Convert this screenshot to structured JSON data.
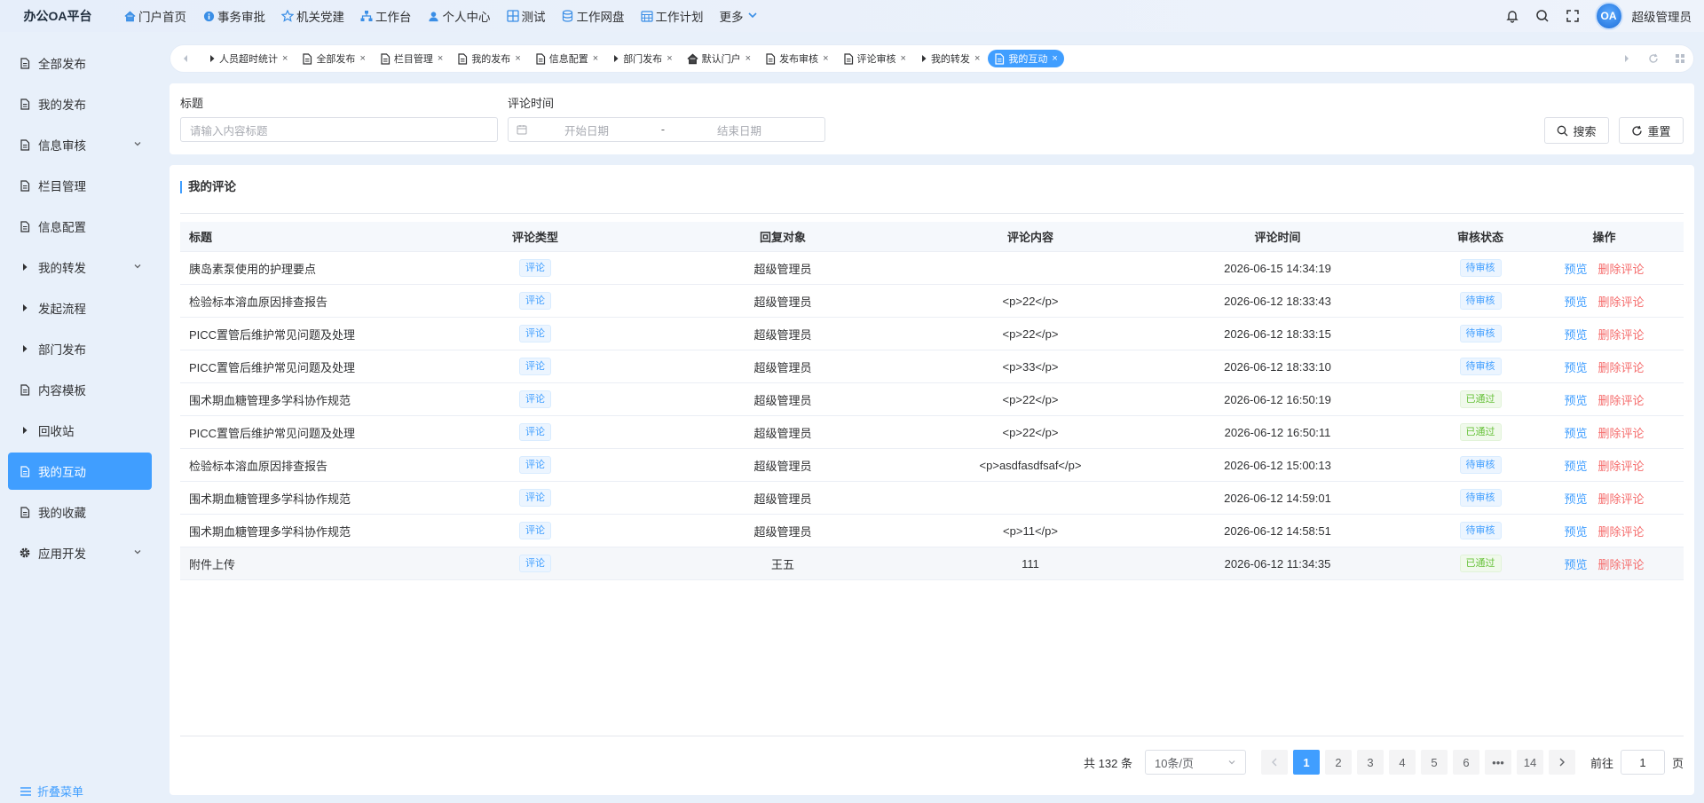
{
  "brand": "办公OA平台",
  "nav": [
    {
      "label": "门户首页",
      "icon": "home-icon"
    },
    {
      "label": "事务审批",
      "icon": "info-icon"
    },
    {
      "label": "机关党建",
      "icon": "star-icon"
    },
    {
      "label": "工作台",
      "icon": "sitemap-icon"
    },
    {
      "label": "个人中心",
      "icon": "user-icon"
    },
    {
      "label": "测试",
      "icon": "grid-icon"
    },
    {
      "label": "工作网盘",
      "icon": "database-icon"
    },
    {
      "label": "工作计划",
      "icon": "calendar-icon"
    }
  ],
  "nav_more": "更多",
  "username": "超级管理员",
  "avatar_text": "OA",
  "sidebar": {
    "items": [
      {
        "label": "全部发布",
        "icon": "document-icon",
        "arrow": false
      },
      {
        "label": "我的发布",
        "icon": "document-icon",
        "arrow": false
      },
      {
        "label": "信息审核",
        "icon": "document-icon",
        "arrow": true
      },
      {
        "label": "栏目管理",
        "icon": "document-icon",
        "arrow": false
      },
      {
        "label": "信息配置",
        "icon": "document-icon",
        "arrow": false
      },
      {
        "label": "我的转发",
        "icon": "caret-right-icon",
        "arrow": true
      },
      {
        "label": "发起流程",
        "icon": "caret-right-icon",
        "arrow": false
      },
      {
        "label": "部门发布",
        "icon": "caret-right-icon",
        "arrow": false
      },
      {
        "label": "内容模板",
        "icon": "document-icon",
        "arrow": false
      },
      {
        "label": "回收站",
        "icon": "caret-right-icon",
        "arrow": false
      },
      {
        "label": "我的互动",
        "icon": "document-icon",
        "arrow": false,
        "active": true
      },
      {
        "label": "我的收藏",
        "icon": "document-icon",
        "arrow": false
      },
      {
        "label": "应用开发",
        "icon": "gear-icon",
        "arrow": true
      }
    ],
    "collapse_label": "折叠菜单"
  },
  "tabs": [
    {
      "label": "人员超时统计",
      "icon": "caret-right-icon"
    },
    {
      "label": "全部发布",
      "icon": "document-icon"
    },
    {
      "label": "栏目管理",
      "icon": "document-icon"
    },
    {
      "label": "我的发布",
      "icon": "document-icon"
    },
    {
      "label": "信息配置",
      "icon": "document-icon"
    },
    {
      "label": "部门发布",
      "icon": "caret-right-icon"
    },
    {
      "label": "默认门户",
      "icon": "home-icon"
    },
    {
      "label": "发布审核",
      "icon": "document-icon"
    },
    {
      "label": "评论审核",
      "icon": "document-icon"
    },
    {
      "label": "我的转发",
      "icon": "caret-right-icon"
    },
    {
      "label": "我的互动",
      "icon": "document-icon",
      "active": true
    }
  ],
  "search": {
    "title_label": "标题",
    "title_placeholder": "请输入内容标题",
    "time_label": "评论时间",
    "start_placeholder": "开始日期",
    "range_sep": "-",
    "end_placeholder": "结束日期",
    "search_button": "搜索",
    "reset_button": "重置"
  },
  "card": {
    "title": "我的评论",
    "columns": [
      "标题",
      "评论类型",
      "回复对象",
      "评论内容",
      "评论时间",
      "审核状态",
      "操作"
    ],
    "rows": [
      {
        "title": "胰岛素泵使用的护理要点",
        "type": "评论",
        "target": "超级管理员",
        "content": "",
        "time": "2026-06-15 14:34:19",
        "status": "待审核",
        "ok": false
      },
      {
        "title": "检验标本溶血原因排查报告",
        "type": "评论",
        "target": "超级管理员",
        "content": "<p>22</p>",
        "time": "2026-06-12 18:33:43",
        "status": "待审核",
        "ok": false
      },
      {
        "title": "PICC置管后维护常见问题及处理",
        "type": "评论",
        "target": "超级管理员",
        "content": "<p>22</p>",
        "time": "2026-06-12 18:33:15",
        "status": "待审核",
        "ok": false
      },
      {
        "title": "PICC置管后维护常见问题及处理",
        "type": "评论",
        "target": "超级管理员",
        "content": "<p>33</p>",
        "time": "2026-06-12 18:33:10",
        "status": "待审核",
        "ok": false
      },
      {
        "title": "围术期血糖管理多学科协作规范",
        "type": "评论",
        "target": "超级管理员",
        "content": "<p>22</p>",
        "time": "2026-06-12 16:50:19",
        "status": "已通过",
        "ok": true
      },
      {
        "title": "PICC置管后维护常见问题及处理",
        "type": "评论",
        "target": "超级管理员",
        "content": "<p>22</p>",
        "time": "2026-06-12 16:50:11",
        "status": "已通过",
        "ok": true
      },
      {
        "title": "检验标本溶血原因排查报告",
        "type": "评论",
        "target": "超级管理员",
        "content": "<p>asdfasdfsaf</p>",
        "time": "2026-06-12 15:00:13",
        "status": "待审核",
        "ok": false
      },
      {
        "title": "围术期血糖管理多学科协作规范",
        "type": "评论",
        "target": "超级管理员",
        "content": "",
        "time": "2026-06-12 14:59:01",
        "status": "待审核",
        "ok": false
      },
      {
        "title": "围术期血糖管理多学科协作规范",
        "type": "评论",
        "target": "超级管理员",
        "content": "<p>11</p>",
        "time": "2026-06-12 14:58:51",
        "status": "待审核",
        "ok": false
      },
      {
        "title": "附件上传",
        "type": "评论",
        "target": "王五",
        "content": "111",
        "time": "2026-06-12 11:34:35",
        "status": "已通过",
        "ok": true
      }
    ],
    "op_preview": "预览",
    "op_delete": "删除评论"
  },
  "pager": {
    "total": "共 132 条",
    "page_size": "10条/页",
    "pages": [
      "1",
      "2",
      "3",
      "4",
      "5",
      "6",
      "•••",
      "14"
    ],
    "current": "1",
    "goto_prefix": "前往",
    "goto_value": "1",
    "goto_suffix": "页"
  },
  "colors": {
    "primary": "#409eff",
    "danger": "#f56c6c",
    "success": "#67c23a"
  }
}
